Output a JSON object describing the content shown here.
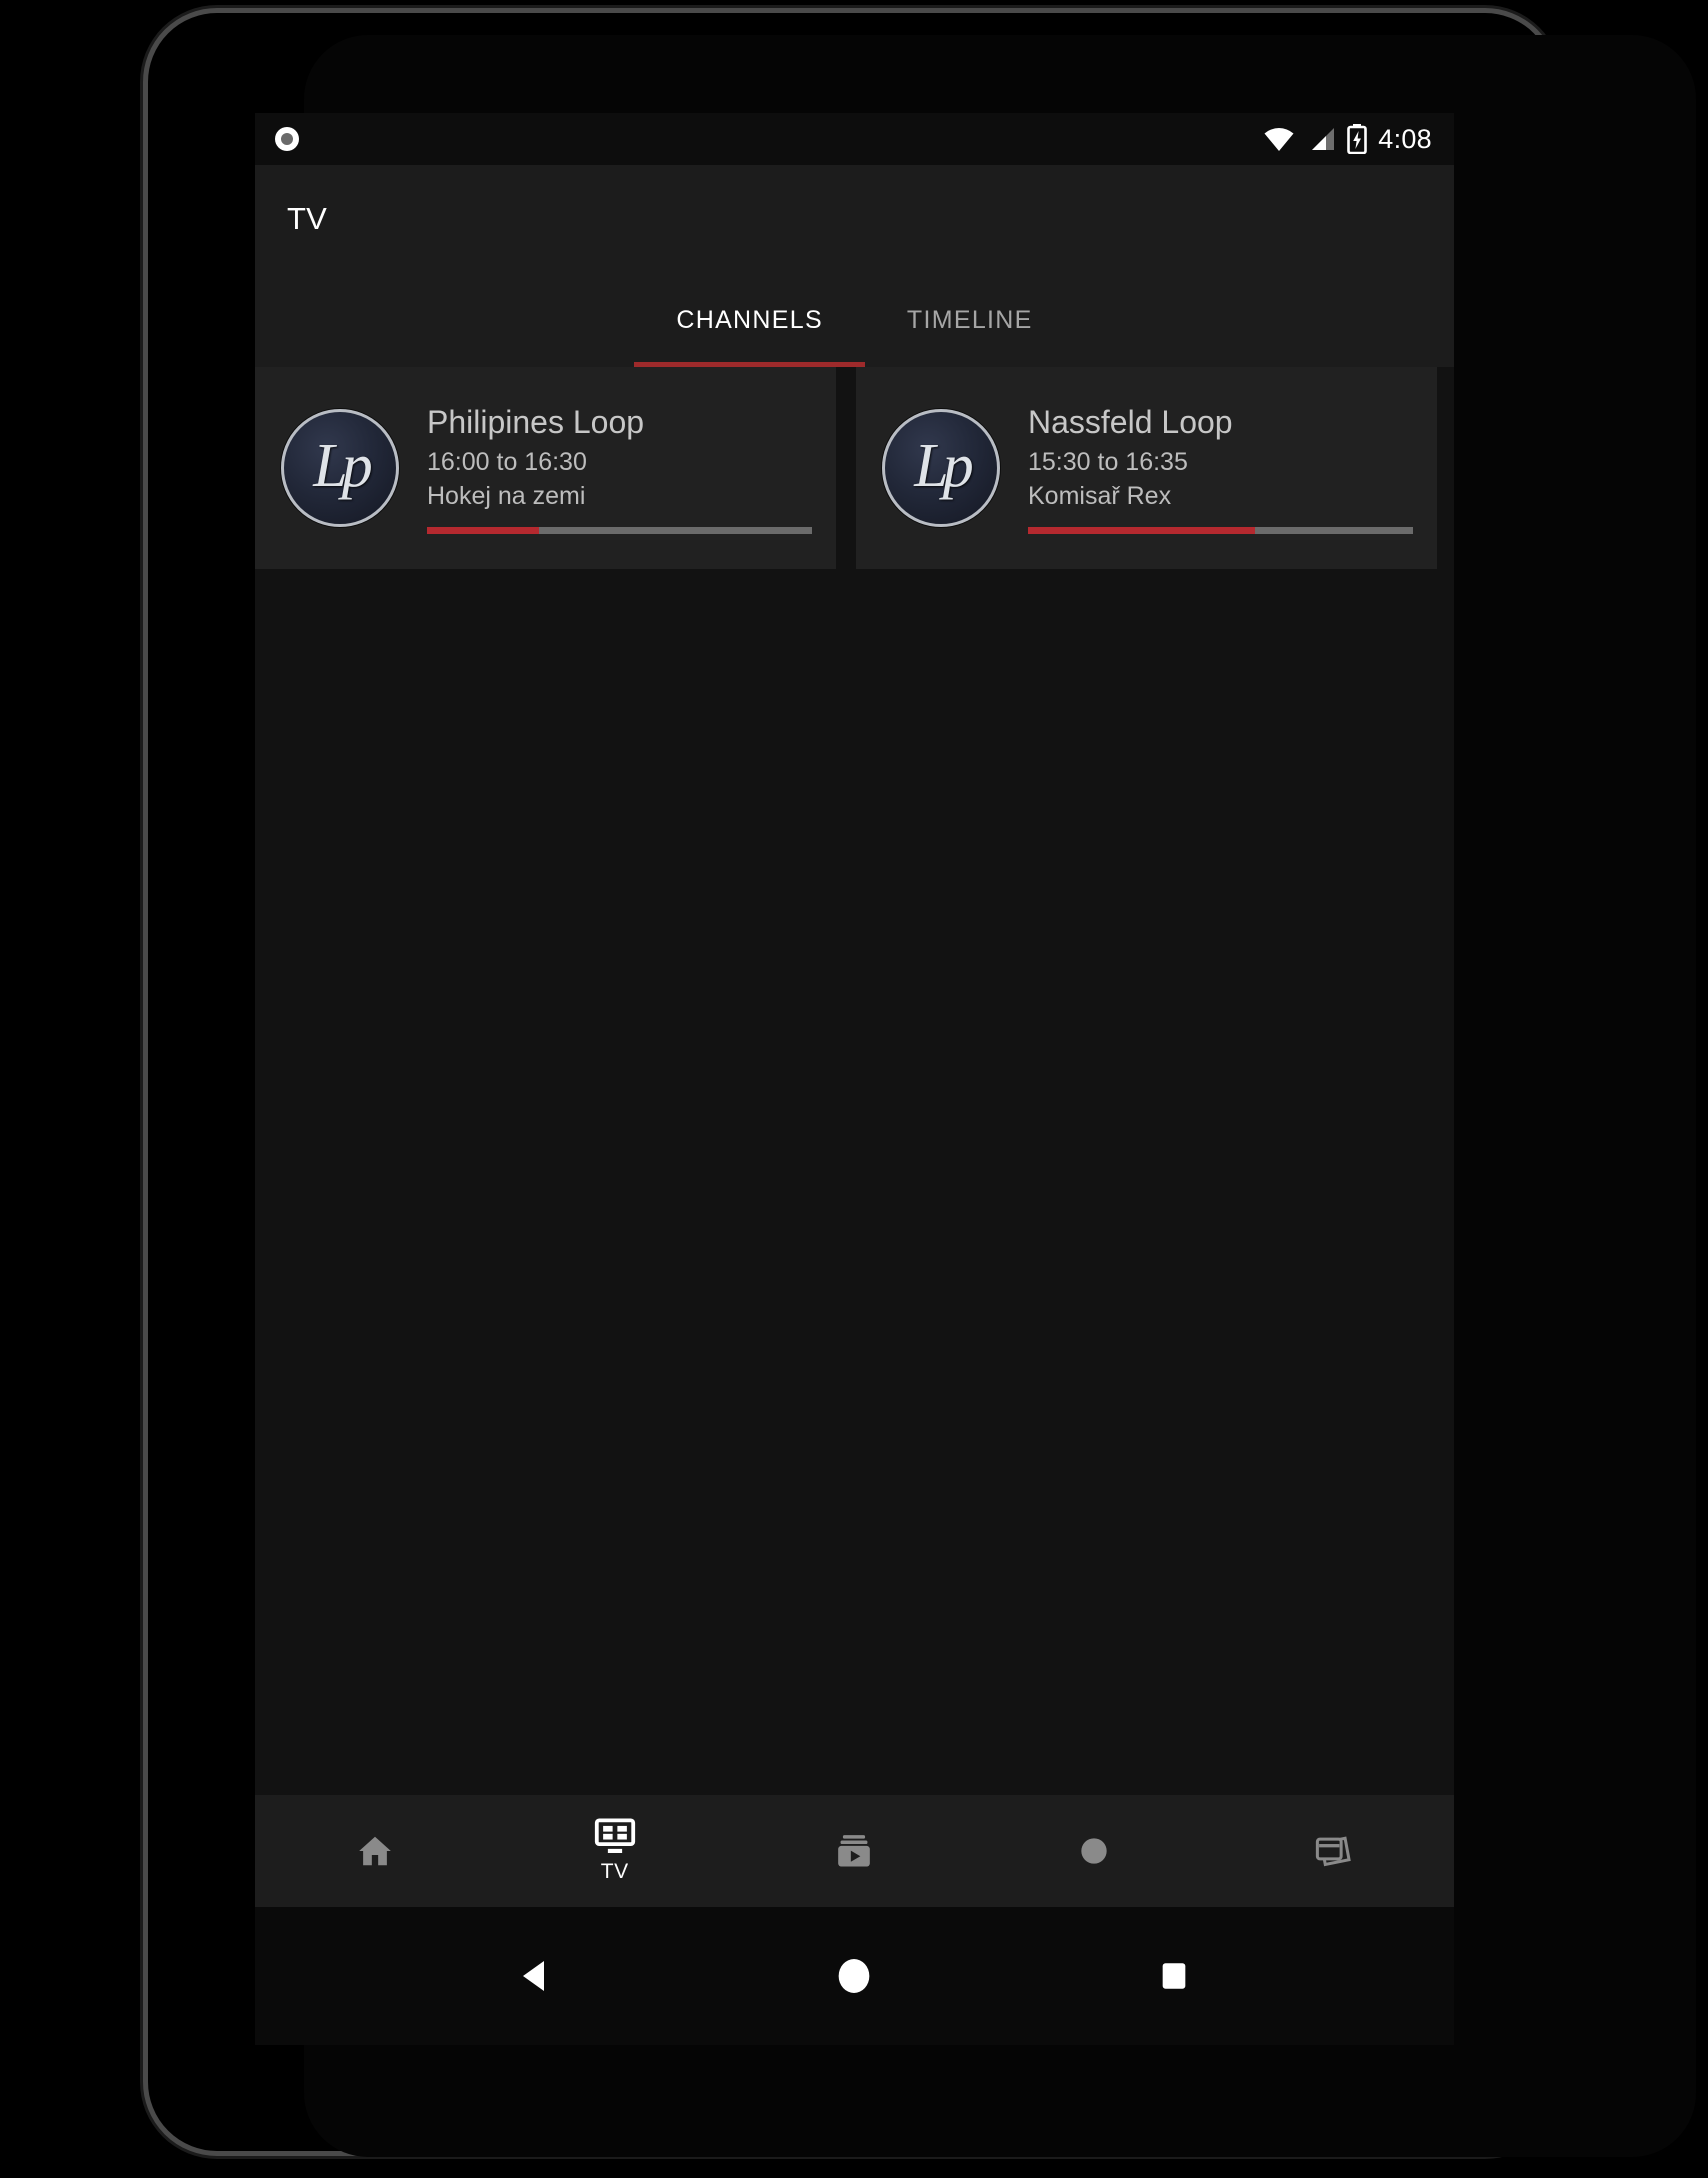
{
  "status_bar": {
    "notification_icon": "record-circle-icon",
    "wifi_icon": "wifi-icon",
    "signal_icon": "cellular-signal-icon",
    "battery_icon": "battery-charging-icon",
    "time": "4:08"
  },
  "app_bar": {
    "title": "TV"
  },
  "tabs": [
    {
      "label": "CHANNELS",
      "active": true
    },
    {
      "label": "TIMELINE",
      "active": false
    }
  ],
  "channels": [
    {
      "logo_text": "Lp",
      "name": "Philipines Loop",
      "time_range": "16:00 to 16:30",
      "program": "Hokej na zemi",
      "progress_percent": 29
    },
    {
      "logo_text": "Lp",
      "name": "Nassfeld Loop",
      "time_range": "15:30 to 16:35",
      "program": "Komisař Rex",
      "progress_percent": 59
    }
  ],
  "bottom_nav": [
    {
      "icon": "home-icon",
      "label": "",
      "active": false
    },
    {
      "icon": "tv-guide-icon",
      "label": "TV",
      "active": true
    },
    {
      "icon": "video-library-icon",
      "label": "",
      "active": false
    },
    {
      "icon": "record-dot-icon",
      "label": "",
      "active": false
    },
    {
      "icon": "cards-stack-icon",
      "label": "",
      "active": false
    }
  ],
  "system_nav": [
    {
      "icon": "back-triangle-icon"
    },
    {
      "icon": "home-circle-icon"
    },
    {
      "icon": "recents-square-icon"
    }
  ],
  "colors": {
    "accent_red": "#b5292f",
    "tab_indicator": "#9e2a2b",
    "screen_bg": "#121212",
    "card_bg": "#212121",
    "app_bar_bg": "#1c1c1c",
    "nav_bg": "#1d1d1d",
    "active_icon": "#ffffff",
    "inactive_icon": "#8a8a8a"
  }
}
